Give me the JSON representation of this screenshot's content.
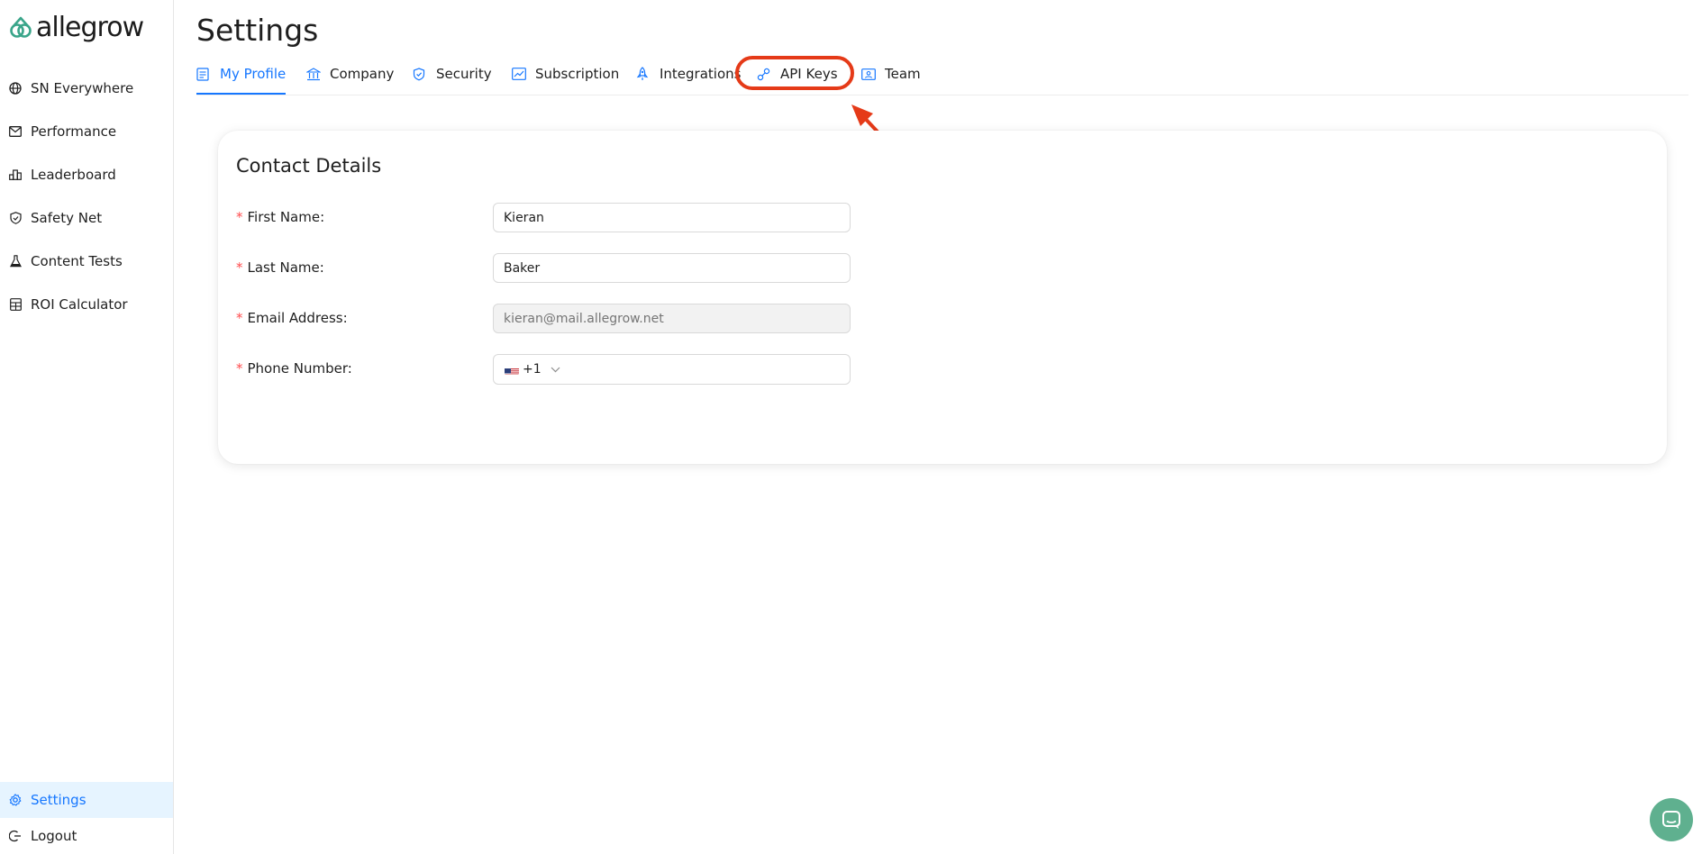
{
  "app": {
    "brand": "allegrow"
  },
  "sidebar": {
    "items": [
      {
        "label": "SN Everywhere",
        "icon": "globe-icon"
      },
      {
        "label": "Performance",
        "icon": "mail-icon"
      },
      {
        "label": "Leaderboard",
        "icon": "podium-icon"
      },
      {
        "label": "Safety Net",
        "icon": "shield-check-icon"
      },
      {
        "label": "Content Tests",
        "icon": "flask-icon"
      },
      {
        "label": "ROI Calculator",
        "icon": "calculator-icon"
      }
    ],
    "footer_items": [
      {
        "label": "Settings",
        "icon": "gear-icon",
        "active": true
      },
      {
        "label": "Logout",
        "icon": "logout-icon"
      }
    ]
  },
  "page": {
    "title": "Settings"
  },
  "tabs": [
    {
      "label": "My Profile",
      "icon": "profile-icon",
      "active": true
    },
    {
      "label": "Company",
      "icon": "bank-icon"
    },
    {
      "label": "Security",
      "icon": "security-icon"
    },
    {
      "label": "Subscription",
      "icon": "chart-icon"
    },
    {
      "label": "Integrations",
      "icon": "rocket-icon"
    },
    {
      "label": "API Keys",
      "icon": "api-icon",
      "highlighted": true
    },
    {
      "label": "Team",
      "icon": "id-card-icon"
    }
  ],
  "contact": {
    "title": "Contact Details",
    "first_name": {
      "label": "First Name",
      "value": "Kieran"
    },
    "last_name": {
      "label": "Last Name",
      "value": "Baker"
    },
    "email": {
      "label": "Email Address",
      "placeholder": "kieran@mail.allegrow.net"
    },
    "phone": {
      "label": "Phone Number",
      "country_code": "+1",
      "value": ""
    }
  },
  "colors": {
    "accent": "#1677ff",
    "active_bg": "#e6f4ff",
    "annotation": "#e53a18",
    "required": "#ff4d4f",
    "chat": "#5fb08f"
  }
}
